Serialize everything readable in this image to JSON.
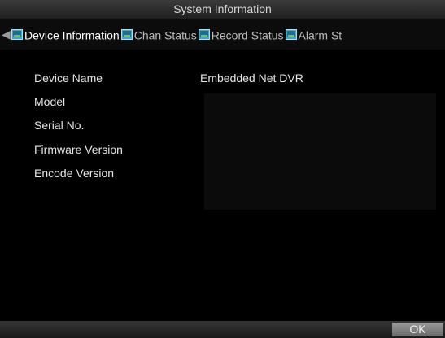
{
  "window": {
    "title": "System Information"
  },
  "tabs": [
    {
      "label": "Device Information",
      "active": true,
      "icon": "monitor-icon"
    },
    {
      "label": "Chan Status",
      "active": false,
      "icon": "monitor-icon"
    },
    {
      "label": "Record Status",
      "active": false,
      "icon": "monitor-icon"
    },
    {
      "label": "Alarm St",
      "active": false,
      "icon": "monitor-icon"
    }
  ],
  "device_info": {
    "rows": [
      {
        "label": "Device Name",
        "value": "Embedded Net DVR"
      },
      {
        "label": "Model",
        "value": ""
      },
      {
        "label": "Serial No.",
        "value": ""
      },
      {
        "label": "Firmware Version",
        "value": ""
      },
      {
        "label": "Encode Version",
        "value": ""
      }
    ]
  },
  "footer": {
    "ok_label": "OK"
  },
  "colors": {
    "background": "#000000",
    "text": "#e6e6e6",
    "tab_icon": "#3fa8c8"
  }
}
